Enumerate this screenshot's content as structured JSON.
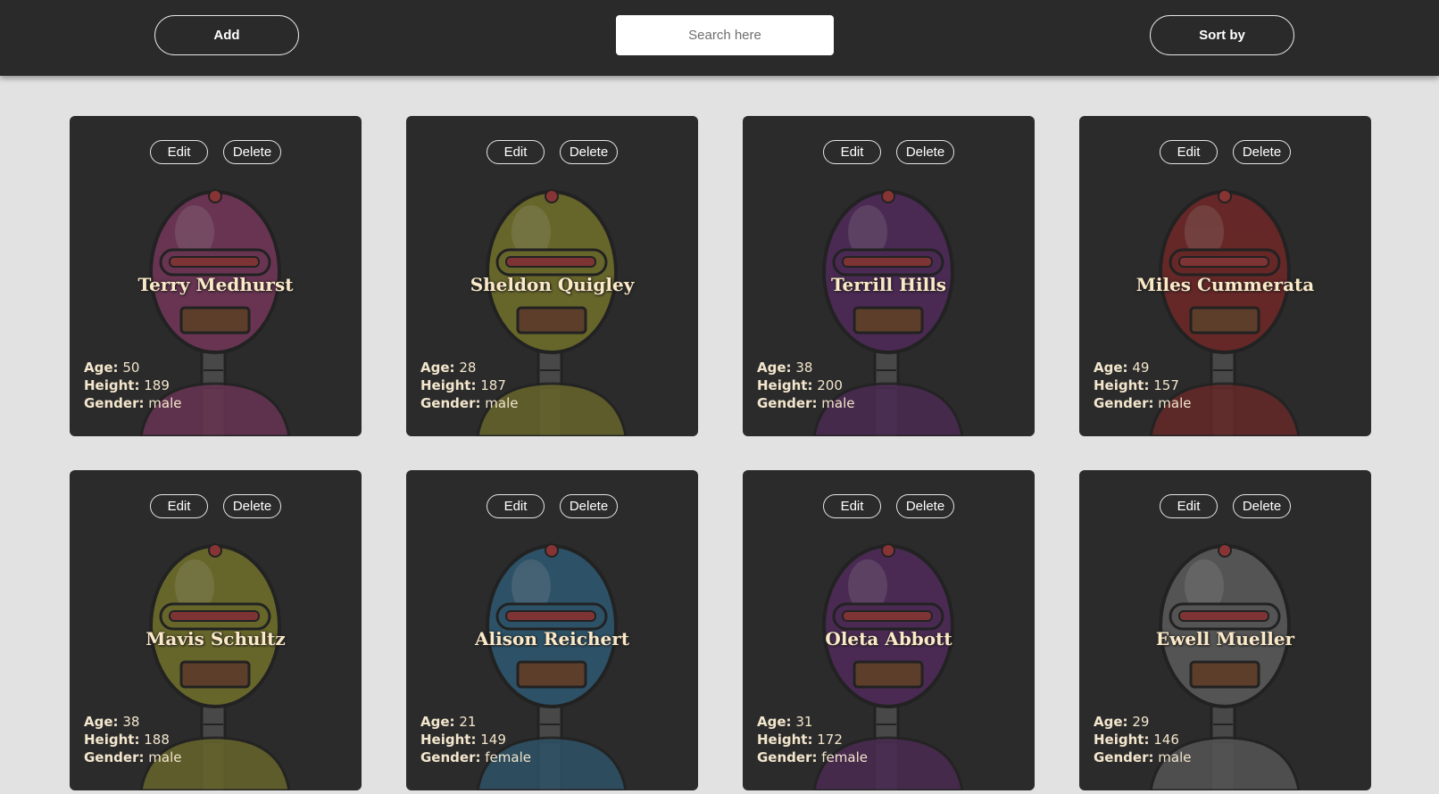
{
  "header": {
    "add_label": "Add",
    "search_placeholder": "Search here",
    "sort_label": "Sort by"
  },
  "card_actions": {
    "edit_label": "Edit",
    "delete_label": "Delete"
  },
  "stat_labels": {
    "age": "Age:",
    "height": "Height:",
    "gender": "Gender:"
  },
  "robots": [
    {
      "name": "Terry Medhurst",
      "age": "50",
      "height": "189",
      "gender": "male",
      "color": "#8e3a6a"
    },
    {
      "name": "Sheldon Quigley",
      "age": "28",
      "height": "187",
      "gender": "male",
      "color": "#8c8a2a"
    },
    {
      "name": "Terrill Hills",
      "age": "38",
      "height": "200",
      "gender": "male",
      "color": "#5e2a6c"
    },
    {
      "name": "Miles Cummerata",
      "age": "49",
      "height": "157",
      "gender": "male",
      "color": "#8a2626"
    },
    {
      "name": "Mavis Schultz",
      "age": "38",
      "height": "188",
      "gender": "male",
      "color": "#8c8a2a"
    },
    {
      "name": "Alison Reichert",
      "age": "21",
      "height": "149",
      "gender": "female",
      "color": "#2f6a8c"
    },
    {
      "name": "Oleta Abbott",
      "age": "31",
      "height": "172",
      "gender": "female",
      "color": "#5e2a6c"
    },
    {
      "name": "Ewell Mueller",
      "age": "29",
      "height": "146",
      "gender": "male",
      "color": "#6e6e6e"
    }
  ]
}
